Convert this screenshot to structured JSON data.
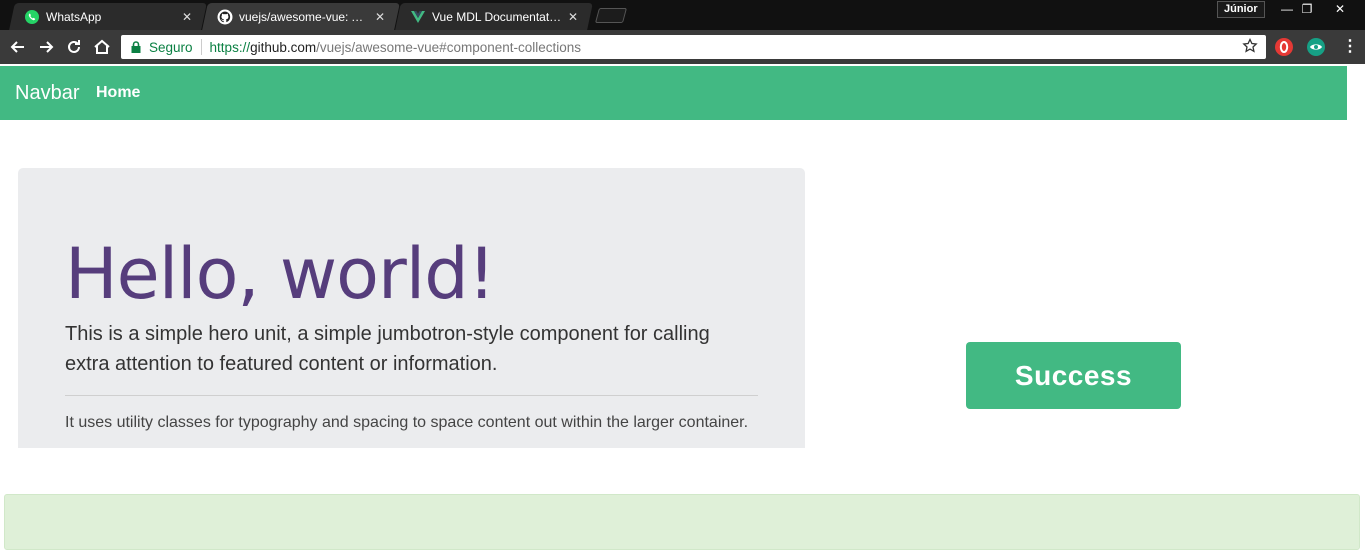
{
  "browser": {
    "tabs": [
      {
        "title": "WhatsApp",
        "icon": "whatsapp-icon"
      },
      {
        "title": "vuejs/awesome-vue: A cu",
        "icon": "github-icon"
      },
      {
        "title": "Vue MDL Documentation",
        "icon": "vue-icon"
      }
    ],
    "close_symbol": "✕",
    "profile": "Júnior",
    "window_controls": {
      "minimize": "—",
      "restore": "❐",
      "close": "✕"
    },
    "address": {
      "secure_label": "Seguro",
      "url_scheme": "https://",
      "url_host": "github.com",
      "url_path": "/vuejs/awesome-vue#component-collections"
    },
    "menu_symbol": "⋮"
  },
  "navbar": {
    "brand": "Navbar",
    "home": "Home",
    "color": "#42b983"
  },
  "jumbotron": {
    "title": "Hello, world!",
    "lead": "This is a simple hero unit, a simple jumbotron-style component for calling extra attention to featured content or information.",
    "body": "It uses utility classes for typography and spacing to space content out within the larger container."
  },
  "success_button": {
    "label": "Success"
  },
  "colors": {
    "accent": "#42b983",
    "title": "#563d7c",
    "jumbotron_bg": "#ebecee",
    "alert_bg": "#dff0d8"
  }
}
